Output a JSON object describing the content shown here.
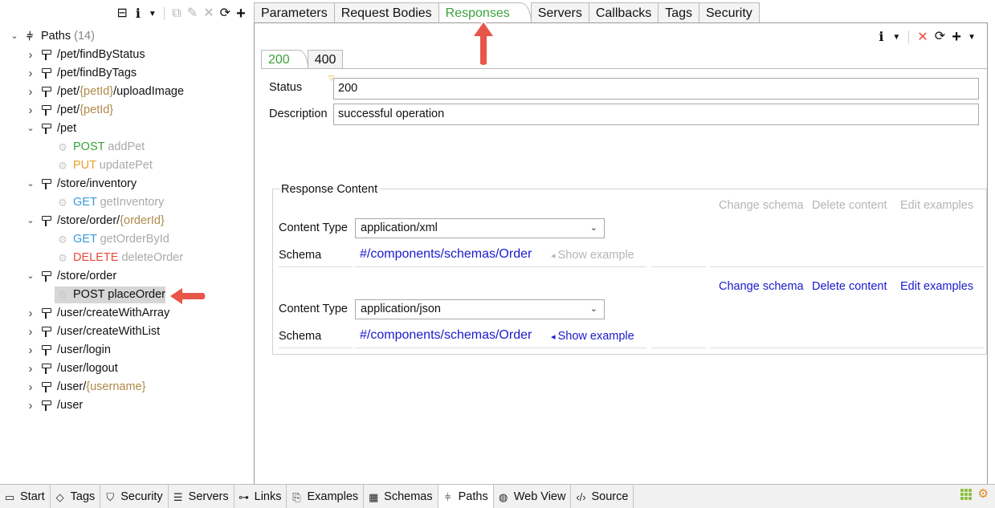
{
  "left_toolbar": {
    "icons": [
      "collapse-all-icon",
      "info-icon",
      "dropdown-caret-icon",
      "copy-icon",
      "edit-icon",
      "delete-icon",
      "refresh-icon",
      "add-icon"
    ]
  },
  "tree": {
    "root_label": "Paths",
    "root_count": "(14)",
    "rows": [
      {
        "kind": "path",
        "parts": [
          {
            "t": "/pet/findByStatus"
          }
        ]
      },
      {
        "kind": "path",
        "parts": [
          {
            "t": "/pet/findByTags"
          }
        ]
      },
      {
        "kind": "path",
        "parts": [
          {
            "t": "/pet/"
          },
          {
            "t": "{petId}",
            "p": true
          },
          {
            "t": "/uploadImage"
          }
        ]
      },
      {
        "kind": "path",
        "parts": [
          {
            "t": "/pet/"
          },
          {
            "t": "{petId}",
            "p": true
          }
        ]
      },
      {
        "kind": "path",
        "expanded": true,
        "parts": [
          {
            "t": "/pet"
          }
        ]
      },
      {
        "kind": "op",
        "method": "POST",
        "mclass": "m-post",
        "name": "addPet"
      },
      {
        "kind": "op",
        "method": "PUT",
        "mclass": "m-put",
        "name": "updatePet"
      },
      {
        "kind": "path",
        "expanded": true,
        "parts": [
          {
            "t": "/store/inventory"
          }
        ]
      },
      {
        "kind": "op",
        "method": "GET",
        "mclass": "m-get",
        "name": "getInventory"
      },
      {
        "kind": "path",
        "expanded": true,
        "parts": [
          {
            "t": "/store/order/"
          },
          {
            "t": "{orderId}",
            "p": true
          }
        ]
      },
      {
        "kind": "op",
        "method": "GET",
        "mclass": "m-get",
        "name": "getOrderById"
      },
      {
        "kind": "op",
        "method": "DELETE",
        "mclass": "m-delete",
        "name": "deleteOrder"
      },
      {
        "kind": "path",
        "expanded": true,
        "parts": [
          {
            "t": "/store/order"
          }
        ]
      },
      {
        "kind": "op",
        "method": "POST",
        "mclass": "",
        "name": "placeOrder",
        "selected": true
      },
      {
        "kind": "path",
        "parts": [
          {
            "t": "/user/createWithArray"
          }
        ]
      },
      {
        "kind": "path",
        "parts": [
          {
            "t": "/user/createWithList"
          }
        ]
      },
      {
        "kind": "path",
        "parts": [
          {
            "t": "/user/login"
          }
        ]
      },
      {
        "kind": "path",
        "parts": [
          {
            "t": "/user/logout"
          }
        ]
      },
      {
        "kind": "path",
        "parts": [
          {
            "t": "/user/"
          },
          {
            "t": "{username}",
            "p": true
          }
        ]
      },
      {
        "kind": "path",
        "parts": [
          {
            "t": "/user"
          }
        ]
      }
    ]
  },
  "top_tabs": [
    "Parameters",
    "Request Bodies",
    "Responses",
    "Servers",
    "Callbacks",
    "Tags",
    "Security"
  ],
  "active_top_tab": "Responses",
  "code_tabs": [
    "200",
    "400"
  ],
  "response": {
    "status_label": "Status",
    "status_value": "200",
    "description_label": "Description",
    "description_value": "successful operation",
    "content_title": "Response Content",
    "change_schema": "Change schema",
    "delete_content": "Delete content",
    "edit_examples": "Edit examples",
    "content_type_label": "Content Type",
    "schema_label": "Schema",
    "contents": [
      {
        "content_type": "application/xml",
        "schema": "#/components/schemas/Order",
        "show_example": "Show example",
        "enabled": false
      },
      {
        "content_type": "application/json",
        "schema": "#/components/schemas/Order",
        "show_example": "Show example",
        "enabled": true
      }
    ]
  },
  "bottom_tabs": [
    {
      "label": "Start",
      "icon": "start-icon"
    },
    {
      "label": "Tags",
      "icon": "tag-icon"
    },
    {
      "label": "Security",
      "icon": "shield-icon"
    },
    {
      "label": "Servers",
      "icon": "server-icon"
    },
    {
      "label": "Links",
      "icon": "link-icon"
    },
    {
      "label": "Examples",
      "icon": "examples-icon"
    },
    {
      "label": "Schemas",
      "icon": "schemas-icon"
    },
    {
      "label": "Paths",
      "icon": "paths-icon"
    },
    {
      "label": "Web View",
      "icon": "globe-icon"
    },
    {
      "label": "Source",
      "icon": "code-icon"
    }
  ],
  "active_bottom_tab": "Paths",
  "colors": {
    "accent_green": "#3aa23a",
    "link_blue": "#1a1acc",
    "annotation_red": "#e8564a",
    "param_brown": "#b0894a"
  }
}
